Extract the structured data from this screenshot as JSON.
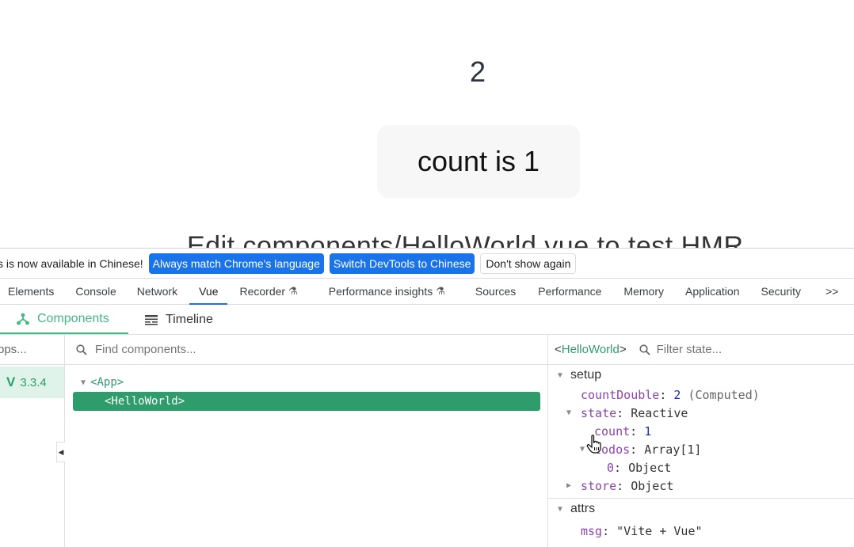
{
  "page": {
    "double_value": "2",
    "count_button": "count is 1",
    "edit_text": "Edit components/HelloWorld.vue to test HMR"
  },
  "infobar": {
    "message": "s is now available in Chinese!",
    "match_language": "Always match Chrome's language",
    "switch_chinese": "Switch DevTools to Chinese",
    "dont_show": "Don't show again"
  },
  "tabs": {
    "elements": "Elements",
    "console": "Console",
    "network": "Network",
    "vue": "Vue",
    "recorder": "Recorder",
    "perf_insights": "Performance insights",
    "sources": "Sources",
    "performance": "Performance",
    "memory": "Memory",
    "application": "Application",
    "security": "Security",
    "more": ">>"
  },
  "vue_tabs": {
    "components": "Components",
    "timeline": "Timeline"
  },
  "apps": {
    "label": "pps...",
    "version": "3.3.4"
  },
  "components": {
    "search_placeholder": "Find components...",
    "tree": {
      "root": "<App>",
      "child": "<HelloWorld>"
    }
  },
  "inspector": {
    "component": "HelloWorld",
    "filter_placeholder": "Filter state...",
    "setup_title": "setup",
    "count_double": {
      "key": "countDouble",
      "value": "2",
      "note": "(Computed)"
    },
    "state": {
      "key": "state",
      "value": "Reactive"
    },
    "count": {
      "key": "count",
      "value": "1"
    },
    "todos": {
      "key": "todos",
      "value": "Array[1]"
    },
    "todo0": {
      "key": "0",
      "value": "Object"
    },
    "store": {
      "key": "store",
      "value": "Object"
    },
    "attrs_title": "attrs",
    "msg": {
      "key": "msg",
      "value": "\"Vite + Vue\""
    }
  },
  "colors": {
    "vue_green": "#42b883",
    "chrome_blue": "#1a73e8"
  }
}
